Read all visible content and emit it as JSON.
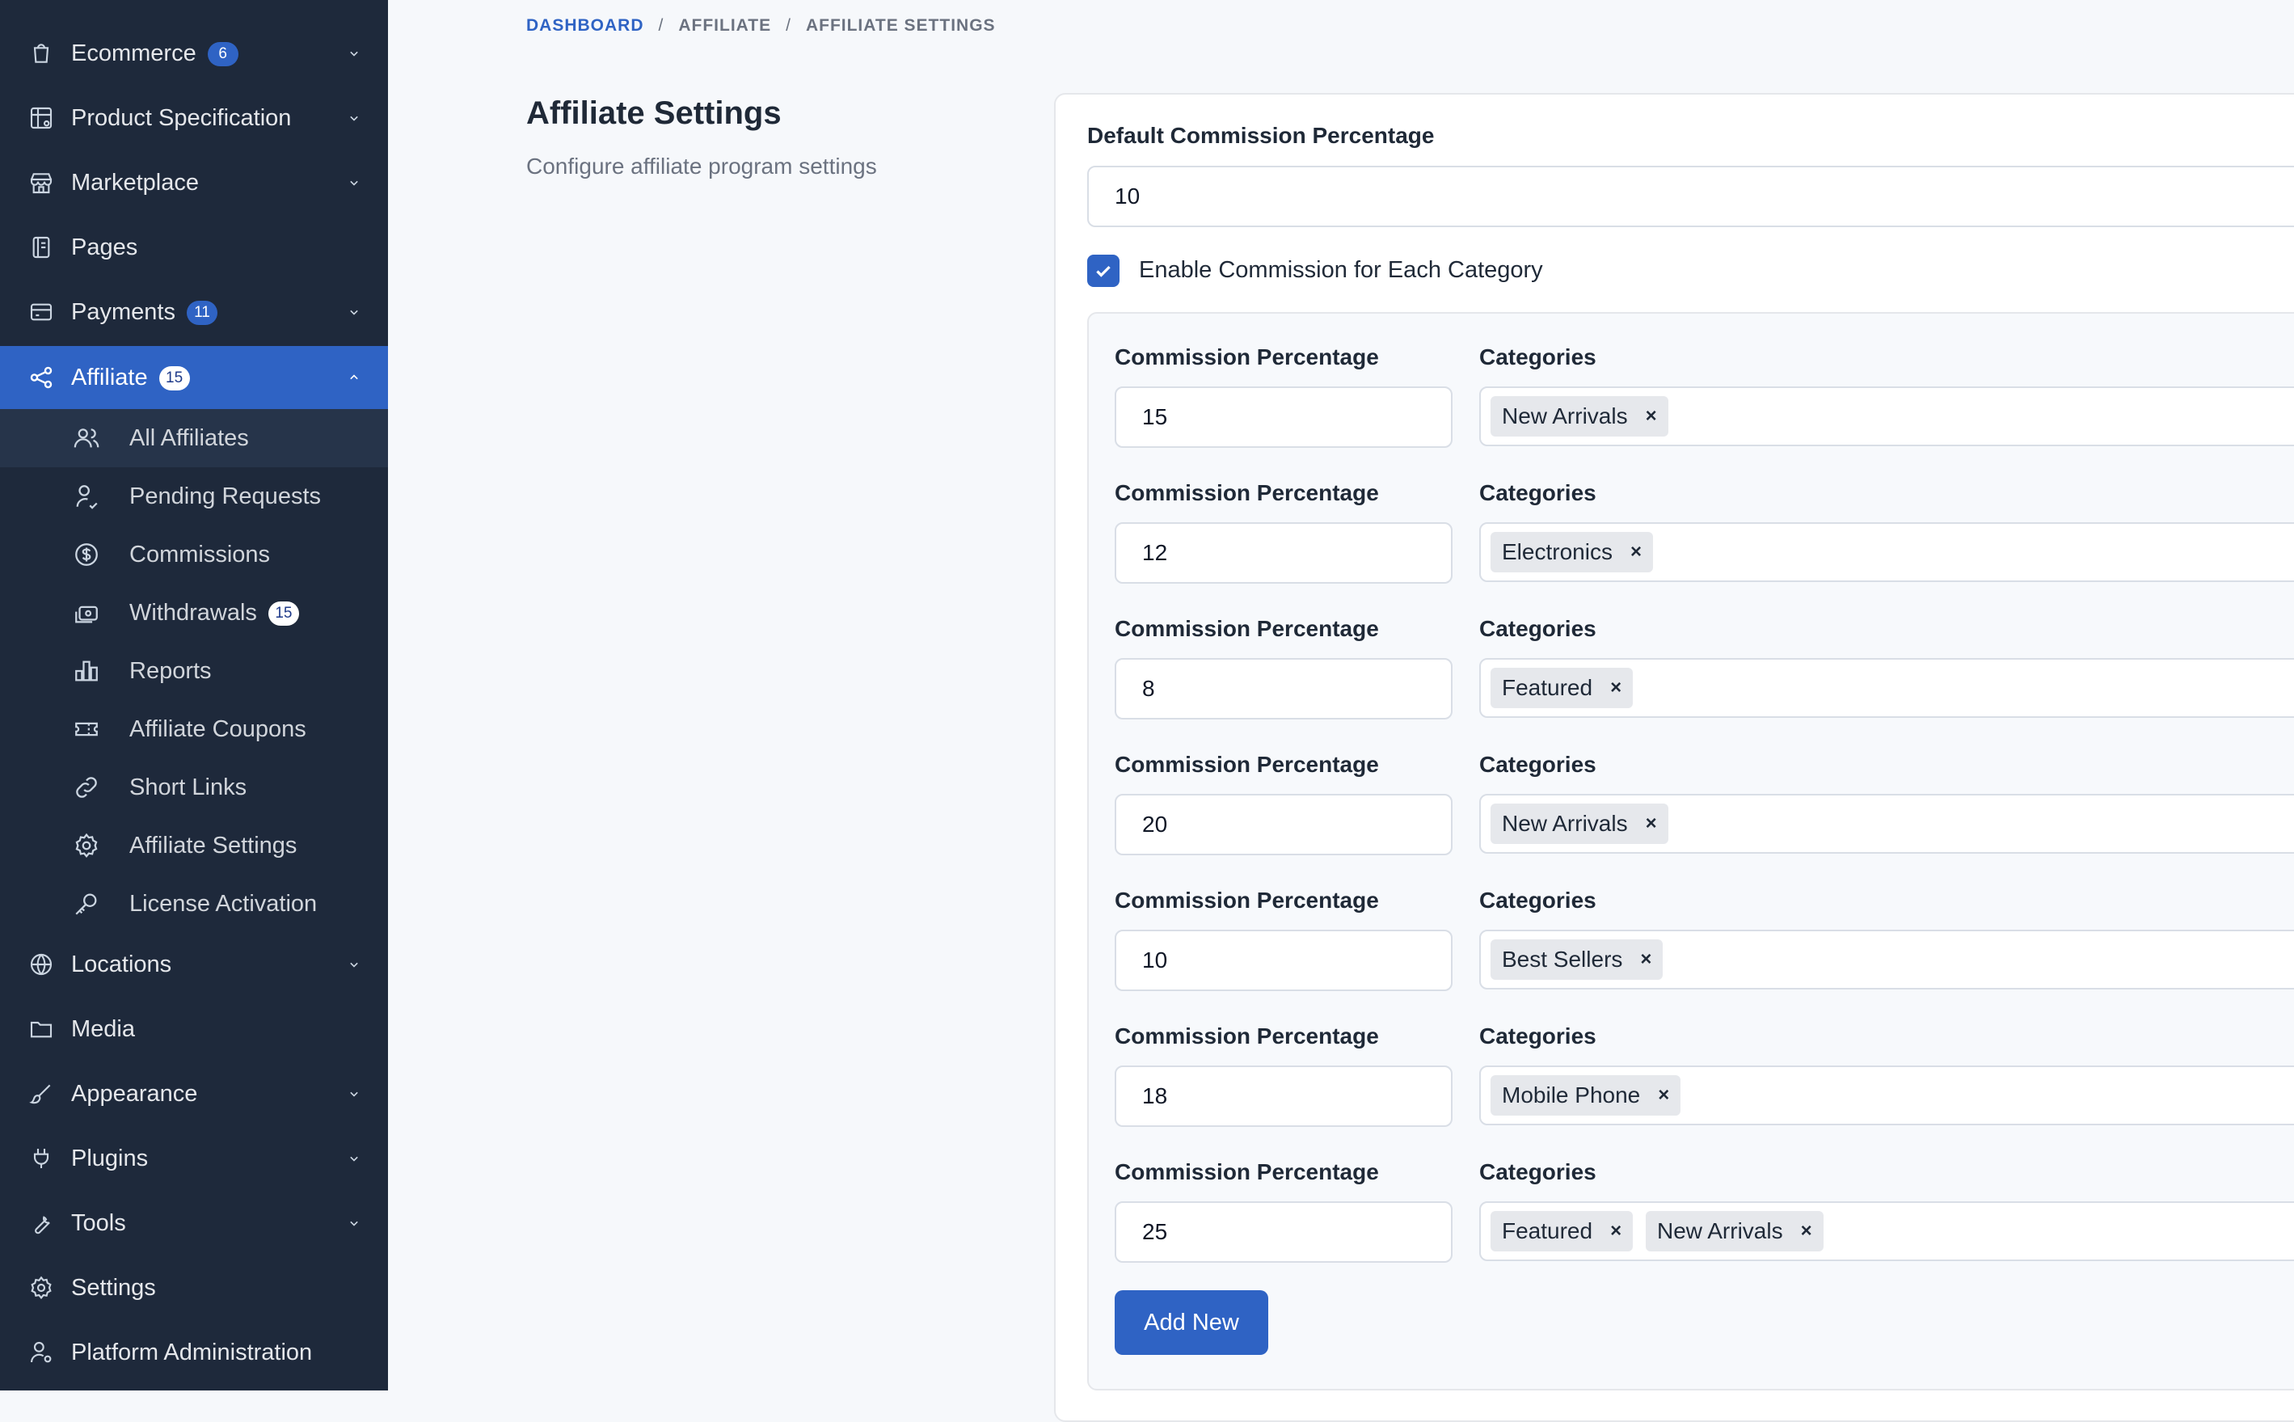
{
  "sidebar": {
    "items": [
      {
        "label": "Ecommerce",
        "badge": "6",
        "has_chevron": true
      },
      {
        "label": "Product Specification",
        "has_chevron": true
      },
      {
        "label": "Marketplace",
        "has_chevron": true
      },
      {
        "label": "Pages",
        "has_chevron": false
      },
      {
        "label": "Payments",
        "badge": "11",
        "has_chevron": true
      },
      {
        "label": "Affiliate",
        "badge": "15",
        "has_chevron": true,
        "active": true
      },
      {
        "label": "Locations",
        "has_chevron": true
      },
      {
        "label": "Media",
        "has_chevron": false
      },
      {
        "label": "Appearance",
        "has_chevron": true
      },
      {
        "label": "Plugins",
        "has_chevron": true
      },
      {
        "label": "Tools",
        "has_chevron": true
      },
      {
        "label": "Settings",
        "has_chevron": false
      },
      {
        "label": "Platform Administration",
        "has_chevron": false
      }
    ],
    "affiliate_sub": [
      {
        "label": "All Affiliates",
        "icon": "users-icon"
      },
      {
        "label": "Pending Requests",
        "icon": "user-clock-icon"
      },
      {
        "label": "Commissions",
        "icon": "dollar-circle-icon"
      },
      {
        "label": "Withdrawals",
        "icon": "cash-icon",
        "badge": "15"
      },
      {
        "label": "Reports",
        "icon": "bar-chart-icon"
      },
      {
        "label": "Affiliate Coupons",
        "icon": "ticket-icon"
      },
      {
        "label": "Short Links",
        "icon": "link-icon"
      },
      {
        "label": "Affiliate Settings",
        "icon": "gear-icon"
      },
      {
        "label": "License Activation",
        "icon": "key-icon"
      }
    ]
  },
  "breadcrumb": {
    "items": [
      "DASHBOARD",
      "AFFILIATE",
      "AFFILIATE SETTINGS"
    ],
    "separator": "/"
  },
  "page": {
    "title": "Affiliate Settings",
    "subtitle": "Configure affiliate program settings"
  },
  "form": {
    "default_commission_label": "Default Commission Percentage",
    "default_commission_value": "10",
    "enable_category_label": "Enable Commission for Each Category",
    "enable_category_checked": true,
    "commission_label": "Commission Percentage",
    "categories_label": "Categories",
    "rows": [
      {
        "percentage": "15",
        "categories": [
          "New Arrivals"
        ]
      },
      {
        "percentage": "12",
        "categories": [
          "Electronics"
        ]
      },
      {
        "percentage": "8",
        "categories": [
          "Featured"
        ]
      },
      {
        "percentage": "20",
        "categories": [
          "New Arrivals"
        ]
      },
      {
        "percentage": "10",
        "categories": [
          "Best Sellers"
        ]
      },
      {
        "percentage": "18",
        "categories": [
          "Mobile Phone"
        ]
      },
      {
        "percentage": "25",
        "categories": [
          "Featured",
          "New Arrivals"
        ]
      }
    ],
    "add_new_label": "Add New"
  },
  "colors": {
    "sidebar_bg": "#1e293b",
    "accent": "#2f63c4",
    "page_bg": "#f6f8fb"
  }
}
